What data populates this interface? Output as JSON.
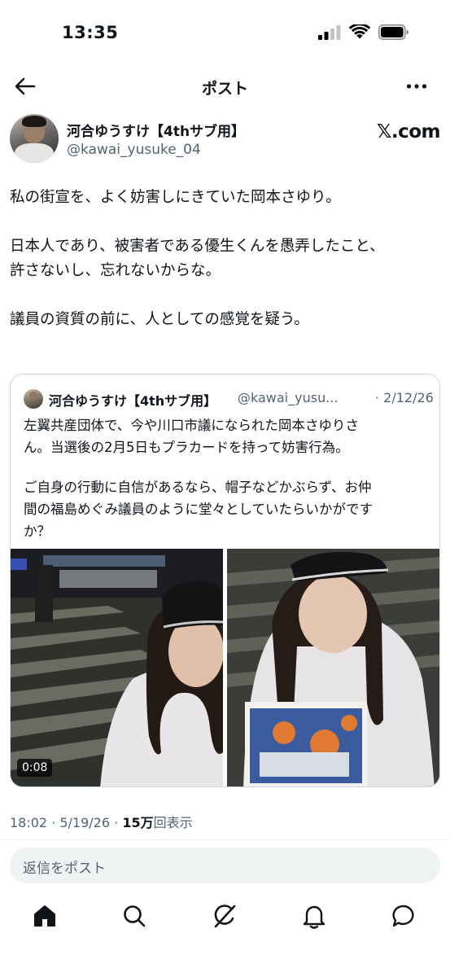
{
  "status_bar": {
    "time": "13:35",
    "icons": [
      "cellular-signal-icon",
      "wifi-icon",
      "battery-icon"
    ]
  },
  "nav": {
    "title": "ポスト",
    "back_icon": "arrow-left-icon",
    "more_icon": "more-horizontal-icon"
  },
  "post": {
    "author_display_name": "河合ゆうすけ【4thサブ用】",
    "author_handle": "@kawai_yusuke_04",
    "source": "𝕏.com",
    "text_lines": [
      "私の街宣を、よく妨害しにきていた岡本さゆり。",
      "",
      "日本人であり、被害者である優生くんを愚弄したこと、",
      "許さないし、忘れないからな。",
      "",
      "議員の資質の前に、人としての感覚を疑う。"
    ],
    "time": "18:02",
    "date": "5/19/26",
    "views_count": "15万",
    "views_label": "回表示"
  },
  "quote": {
    "display_name": "河合ゆうすけ【4thサブ用】",
    "handle": "@kawai_yusu...",
    "date": "· 2/12/26",
    "text_lines": [
      "左翼共産団体で、今や川口市議になられた岡本さゆりさ",
      "ん。当選後の2月5日もプラカードを持って妨害行為。",
      "",
      "ご自身の行動に自信があるなら、帽子などかぶらず、お仲",
      "間の福島めぐみ議員のように堂々としていたらいかがです",
      "か？"
    ],
    "video_duration": "0:08"
  },
  "reply": {
    "placeholder": "返信をポスト"
  },
  "tabbar": {
    "items": [
      {
        "name": "home",
        "icon": "home-icon",
        "active": true
      },
      {
        "name": "search",
        "icon": "search-icon",
        "active": false
      },
      {
        "name": "grok",
        "icon": "grok-icon",
        "active": false
      },
      {
        "name": "notifications",
        "icon": "bell-icon",
        "active": false
      },
      {
        "name": "messages",
        "icon": "message-icon",
        "active": false
      }
    ]
  },
  "colors": {
    "text": "#0f1419",
    "secondary": "#536471",
    "border": "#cfd9de",
    "background": "#ffffff",
    "reply_bg": "#eff3f4"
  }
}
